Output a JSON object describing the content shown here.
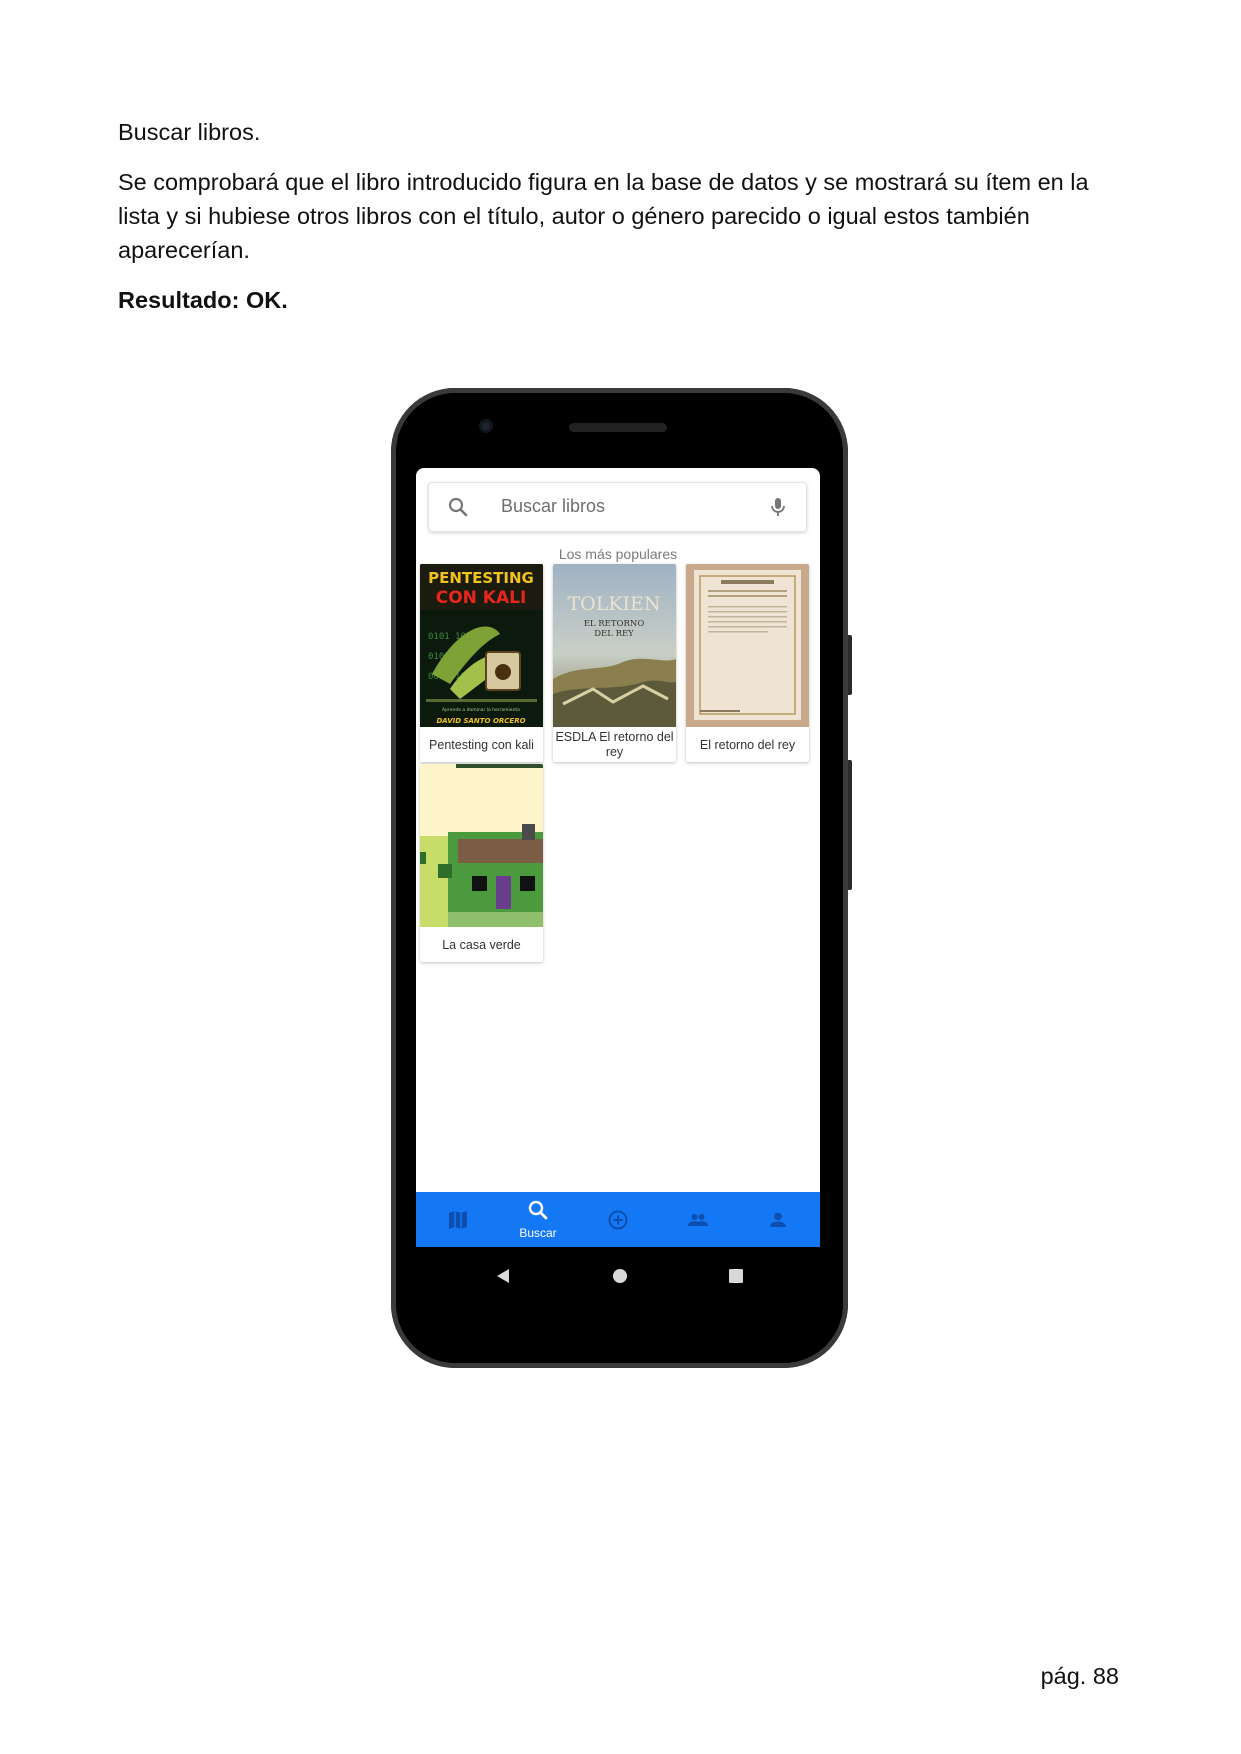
{
  "document": {
    "heading": "Buscar libros.",
    "paragraph": "Se comprobará que el libro introducido figura en la base de datos y se mostrará su ítem en la lista y si hubiese otros libros con el título, autor o género parecido o igual estos también aparecerían.",
    "result": "Resultado: OK.",
    "page_number": "pág. 88"
  },
  "app": {
    "search": {
      "placeholder": "Buscar libros",
      "icon": "search-icon",
      "mic_icon": "mic-icon"
    },
    "section_label": "Los más populares",
    "books": [
      {
        "title": "Pentesting con kali",
        "cover_text": [
          "PENTESTING",
          "CON KALI",
          "DAVID SANTO ORCERO"
        ]
      },
      {
        "title": "ESDLA El retorno del rey",
        "cover_text": [
          "TOLKIEN",
          "EL RETORNO",
          "DEL REY"
        ]
      },
      {
        "title": "El retorno del rey",
        "cover_text": []
      },
      {
        "title": "La casa verde",
        "cover_text": []
      }
    ],
    "bottom_nav": [
      {
        "icon": "map-icon",
        "label": ""
      },
      {
        "icon": "search-icon",
        "label": "Buscar",
        "active": true
      },
      {
        "icon": "add-circle-icon",
        "label": ""
      },
      {
        "icon": "people-icon",
        "label": ""
      },
      {
        "icon": "person-icon",
        "label": ""
      }
    ],
    "accent_color": "#1478f5"
  }
}
